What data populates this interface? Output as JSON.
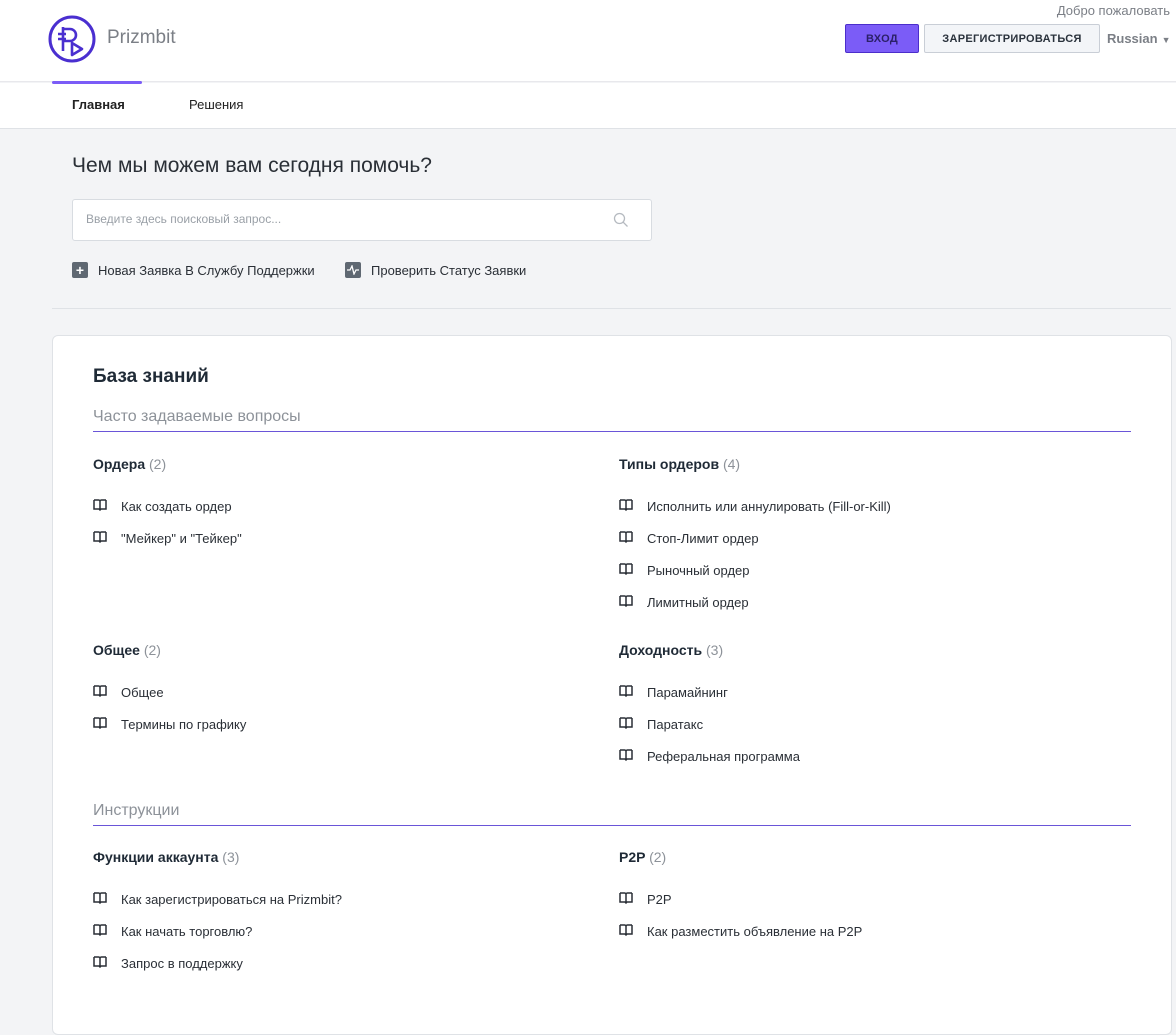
{
  "header": {
    "brand": "Prizmbit",
    "welcome": "Добро пожаловать",
    "login": "ВХОД",
    "register": "ЗАРЕГИСТРИРОВАТЬСЯ",
    "language": "Russian"
  },
  "nav": {
    "tabs": [
      {
        "label": "Главная"
      },
      {
        "label": "Решения"
      }
    ]
  },
  "hero": {
    "title": "Чем мы можем вам сегодня помочь?",
    "search_placeholder": "Введите здесь поисковый запрос...",
    "new_ticket": "Новая Заявка В Службу Поддержки",
    "check_status": "Проверить Статус Заявки"
  },
  "kb": {
    "title": "База знаний",
    "sections": [
      {
        "title": "Часто задаваемые вопросы",
        "categories": [
          {
            "name": "Ордера",
            "count": "(2)",
            "articles": [
              "Как создать ордер",
              "\"Мейкер\" и \"Тейкер\""
            ]
          },
          {
            "name": "Типы ордеров",
            "count": "(4)",
            "articles": [
              "Исполнить или аннулировать (Fill-or-Kill)",
              "Стоп-Лимит ордер",
              "Рыночный ордер",
              "Лимитный ордер"
            ]
          },
          {
            "name": "Общее",
            "count": "(2)",
            "articles": [
              "Общее",
              "Термины по графику"
            ]
          },
          {
            "name": "Доходность",
            "count": "(3)",
            "articles": [
              "Парамайнинг",
              "Паратакс",
              "Реферальная программа"
            ]
          }
        ]
      },
      {
        "title": "Инструкции",
        "categories": [
          {
            "name": "Функции аккаунта",
            "count": "(3)",
            "articles": [
              "Как зарегистрироваться на Prizmbit?",
              "Как начать торговлю?",
              "Запрос в поддержку"
            ]
          },
          {
            "name": "P2P",
            "count": "(2)",
            "articles": [
              "P2P",
              "Как разместить объявление на P2P"
            ]
          }
        ]
      }
    ]
  }
}
